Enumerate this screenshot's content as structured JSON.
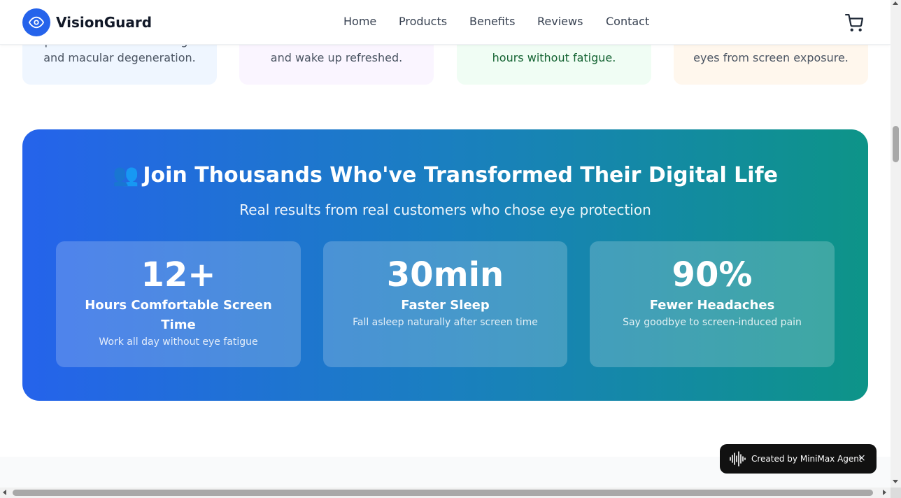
{
  "brand": {
    "name": "VisionGuard",
    "logo_icon": "eye-icon",
    "accent_color": "#2563eb"
  },
  "nav": {
    "items": [
      "Home",
      "Products",
      "Benefits",
      "Reviews",
      "Contact"
    ],
    "cart_icon": "cart-icon"
  },
  "benefit_cards": [
    {
      "text_line1": "permanent retinal damage",
      "text_line2": "and macular degeneration.",
      "color": "#eff6ff"
    },
    {
      "text_line1": "and wake up refreshed.",
      "color": "#faf5ff"
    },
    {
      "text_line1": "hours without fatigue.",
      "color": "#f0fdf4"
    },
    {
      "text_line1": "eyes from screen exposure.",
      "color": "#fff7ed"
    }
  ],
  "hero": {
    "emoji": "👥",
    "title": "Join Thousands Who've Transformed Their Digital Life",
    "subtitle": "Real results from real customers who chose eye protection",
    "gradient": [
      "#2563eb",
      "#0d9488"
    ],
    "stats": [
      {
        "value": "12+",
        "label": "Hours Comfortable Screen Time",
        "desc": "Work all day without eye fatigue"
      },
      {
        "value": "30min",
        "label": "Faster Sleep",
        "desc": "Fall asleep naturally after screen time"
      },
      {
        "value": "90%",
        "label": "Fewer Headaches",
        "desc": "Say goodbye to screen-induced pain"
      }
    ]
  },
  "agent_badge": {
    "label": "Created by MiniMax Agent",
    "icon": "waveform-icon",
    "close": "×"
  }
}
